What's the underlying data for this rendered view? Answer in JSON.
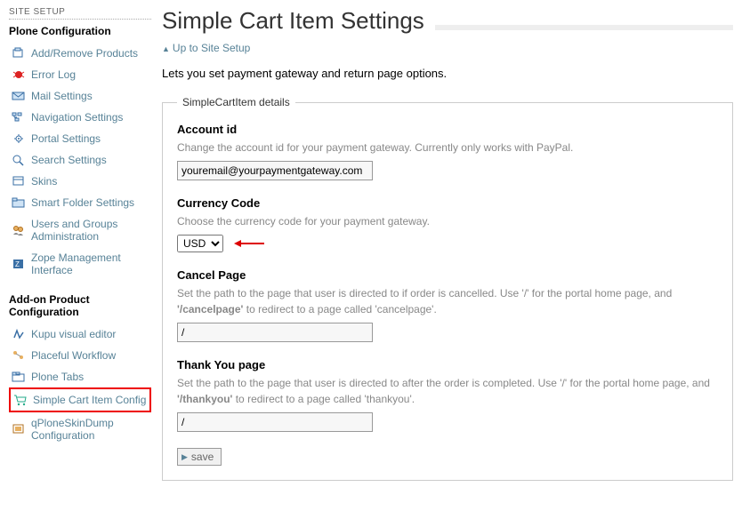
{
  "sidebar": {
    "heading": "SITE SETUP",
    "plone_section_title": "Plone Configuration",
    "addon_section_title": "Add-on Product Configuration",
    "items_plone": [
      {
        "label": "Add/Remove Products",
        "icon": "square-blue"
      },
      {
        "label": "Error Log",
        "icon": "bug-red"
      },
      {
        "label": "Mail Settings",
        "icon": "mail-blue"
      },
      {
        "label": "Navigation Settings",
        "icon": "nav-blue"
      },
      {
        "label": "Portal Settings",
        "icon": "gear-blue"
      },
      {
        "label": "Search Settings",
        "icon": "search-blue"
      },
      {
        "label": "Skins",
        "icon": "skins-blue"
      },
      {
        "label": "Smart Folder Settings",
        "icon": "folder-blue"
      },
      {
        "label": "Users and Groups Administration",
        "icon": "users"
      },
      {
        "label": "Zope Management Interface",
        "icon": "zope-blue"
      }
    ],
    "items_addon": [
      {
        "label": "Kupu visual editor",
        "icon": "kupu"
      },
      {
        "label": "Placeful Workflow",
        "icon": "workflow"
      },
      {
        "label": "Plone Tabs",
        "icon": "tabs"
      },
      {
        "label": "Simple Cart Item Config",
        "icon": "cart",
        "highlight": true
      },
      {
        "label": "qPloneSkinDump Configuration",
        "icon": "skin-dump"
      }
    ]
  },
  "page": {
    "title": "Simple Cart Item Settings",
    "up_link": "Up to Site Setup",
    "intro": "Lets you set payment gateway and return page options."
  },
  "form": {
    "legend": "SimpleCartItem details",
    "account": {
      "label": "Account id",
      "help": "Change the account id for your payment gateway. Currently only works with PayPal.",
      "value": "youremail@yourpaymentgateway.com"
    },
    "currency": {
      "label": "Currency Code",
      "help": "Choose the currency code for your payment gateway.",
      "selected": "USD"
    },
    "cancel": {
      "label": "Cancel Page",
      "help_pre": "Set the path to the page that user is directed to if order is cancelled. Use '/' for the portal home page, and ",
      "help_strong": "'/cancelpage'",
      "help_post": " to redirect to a page called 'cancelpage'.",
      "value": "/"
    },
    "thankyou": {
      "label": "Thank You page",
      "help_pre": "Set the path to the page that user is directed to after the order is completed. Use '/' for the portal home page, and ",
      "help_strong": "'/thankyou'",
      "help_post": " to redirect to a page called 'thankyou'.",
      "value": "/"
    },
    "save_label": "save"
  }
}
